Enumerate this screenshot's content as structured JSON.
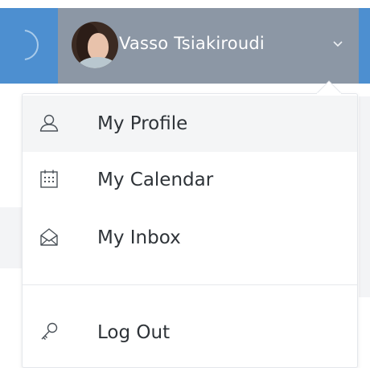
{
  "header": {
    "user_name": "Vasso Tsiakiroudi",
    "avatar_icon": "user-avatar",
    "toggle_icon": "chevron-down-icon",
    "bar_color": "#8c97a5",
    "accent_color": "#4d8fd0"
  },
  "user_menu": {
    "items": [
      {
        "label": "My Profile",
        "icon": "user-icon"
      },
      {
        "label": "My Calendar",
        "icon": "calendar-icon"
      },
      {
        "label": "My Inbox",
        "icon": "envelope-open-icon"
      },
      {
        "label": "Log Out",
        "icon": "key-icon"
      }
    ],
    "hover_bg": "#f4f5f6"
  }
}
